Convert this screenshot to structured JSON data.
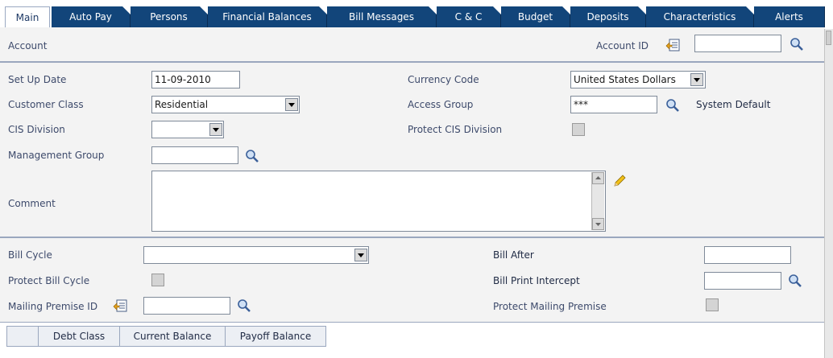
{
  "tabs": [
    "Main",
    "Auto Pay",
    "Persons",
    "Financial Balances",
    "Bill Messages",
    "C & C",
    "Budget",
    "Deposits",
    "Characteristics",
    "Alerts"
  ],
  "header": {
    "section_label": "Account",
    "account_id_label": "Account ID",
    "account_id_value": ""
  },
  "main": {
    "setup_date_label": "Set Up Date",
    "setup_date_value": "11-09-2010",
    "currency_code_label": "Currency Code",
    "currency_code_value": "United States Dollars",
    "customer_class_label": "Customer Class",
    "customer_class_value": "Residential",
    "access_group_label": "Access Group",
    "access_group_value": "***",
    "access_group_desc": "System Default",
    "cis_division_label": "CIS Division",
    "cis_division_value": "",
    "protect_cis_label": "Protect CIS Division",
    "management_group_label": "Management Group",
    "management_group_value": "",
    "comment_label": "Comment",
    "comment_value": ""
  },
  "billing": {
    "bill_cycle_label": "Bill Cycle",
    "bill_cycle_value": "",
    "bill_after_label": "Bill After",
    "bill_after_value": "",
    "protect_bill_cycle_label": "Protect Bill Cycle",
    "bill_print_intercept_label": "Bill Print Intercept",
    "bill_print_intercept_value": "",
    "mailing_premise_label": "Mailing Premise ID",
    "mailing_premise_value": "",
    "protect_mailing_label": "Protect Mailing Premise"
  },
  "grid": {
    "columns": [
      "Debt Class",
      "Current Balance",
      "Payoff Balance"
    ]
  },
  "colors": {
    "tab_bg": "#12457a",
    "panel_bg": "#f3f3f3",
    "label": "#3d4a6b",
    "separator": "#9aa7be"
  },
  "icons": [
    "search-icon",
    "context-menu-icon",
    "dropdown-arrow-icon",
    "pencil-icon",
    "scroll-up-icon",
    "scroll-down-icon"
  ]
}
